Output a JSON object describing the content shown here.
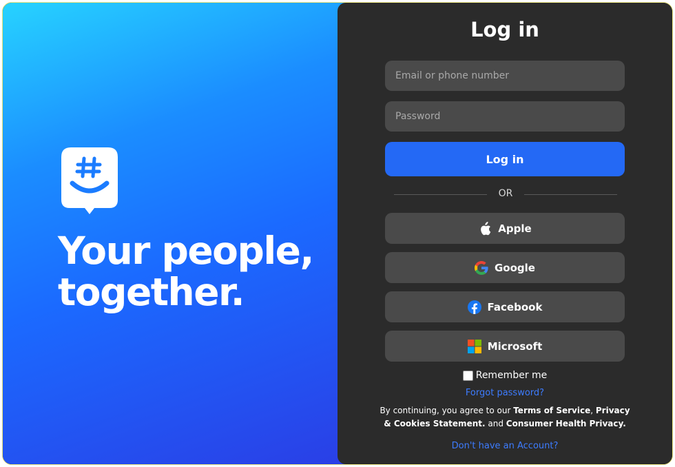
{
  "hero": {
    "tagline_line1": "Your people,",
    "tagline_line2": "together."
  },
  "login": {
    "title": "Log in",
    "email_placeholder": "Email or phone number",
    "password_placeholder": "Password",
    "submit_label": "Log in",
    "divider_text": "OR",
    "social": {
      "apple": "Apple",
      "google": "Google",
      "facebook": "Facebook",
      "microsoft": "Microsoft"
    },
    "remember_label": "Remember me",
    "forgot_label": "Forgot password?",
    "terms": {
      "prefix": "By continuing, you agree to our ",
      "terms_of_service": "Terms of Service",
      "comma": ", ",
      "privacy": "Privacy & Cookies Statement.",
      "and": " and ",
      "health": "Consumer Health Privacy."
    },
    "signup_label": "Don't have an Account?"
  },
  "colors": {
    "primary_blue": "#2469f5",
    "link_blue": "#3d7cff",
    "panel_bg": "#2b2b2b",
    "input_bg": "#4a4a4a"
  },
  "icons": [
    "groupme-logo-icon",
    "apple-icon",
    "google-icon",
    "facebook-icon",
    "microsoft-icon"
  ]
}
